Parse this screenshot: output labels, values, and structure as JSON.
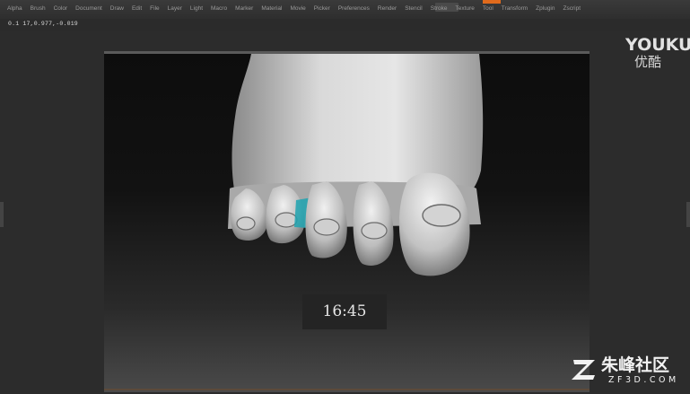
{
  "menu": {
    "items": [
      "Alpha",
      "Brush",
      "Color",
      "Document",
      "Draw",
      "Edit",
      "File",
      "Layer",
      "Light",
      "Macro",
      "Marker",
      "Material",
      "Movie",
      "Picker",
      "Preferences",
      "Render",
      "Stencil",
      "Stroke",
      "Texture",
      "Tool",
      "Transform",
      "Zplugin",
      "Zscript"
    ]
  },
  "status": {
    "coords": "0.1 17,0.977,-0.019"
  },
  "video": {
    "timestamp": "16:45"
  },
  "watermarks": {
    "youku_en": "YOUKU",
    "youku_cn": "优酷",
    "zf3d_cn": "朱峰社区",
    "zf3d_en": "ZF3D.COM"
  },
  "colors": {
    "accent": "#e06a1c",
    "brush_cursor": "#1fa3b0"
  },
  "icons": {
    "viewport_model": "foot-sculpt",
    "brush_cursor": "brush-cursor-icon",
    "zf3d_logo": "zf3d-logo-icon"
  }
}
